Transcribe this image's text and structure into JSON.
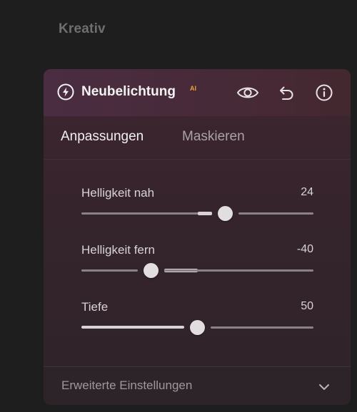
{
  "section": {
    "title": "Kreativ"
  },
  "panel": {
    "title": "Neubelichtung",
    "badge": "AI",
    "icons": [
      "bolt-icon",
      "eye-icon",
      "undo-icon",
      "info-icon"
    ]
  },
  "tabs": [
    {
      "label": "Anpassungen",
      "active": true
    },
    {
      "label": "Maskieren",
      "active": false
    }
  ],
  "sliders": [
    {
      "label": "Helligkeit nah",
      "value": "24",
      "level": 24,
      "min": -100,
      "max": 100
    },
    {
      "label": "Helligkeit fern",
      "value": "-40",
      "level": -40,
      "min": -100,
      "max": 100
    },
    {
      "label": "Tiefe",
      "value": "50",
      "level": 50,
      "min": 0,
      "max": 100
    }
  ],
  "footer": {
    "label": "Erweiterte Einstellungen",
    "icon": "chevron-down-icon"
  },
  "colors": {
    "background": "#1e1e1e",
    "panel_header": "#4b2d42",
    "ai_badge": "#e8a23c",
    "track": "#8a8386",
    "track_fill": "#d9d3d6"
  }
}
